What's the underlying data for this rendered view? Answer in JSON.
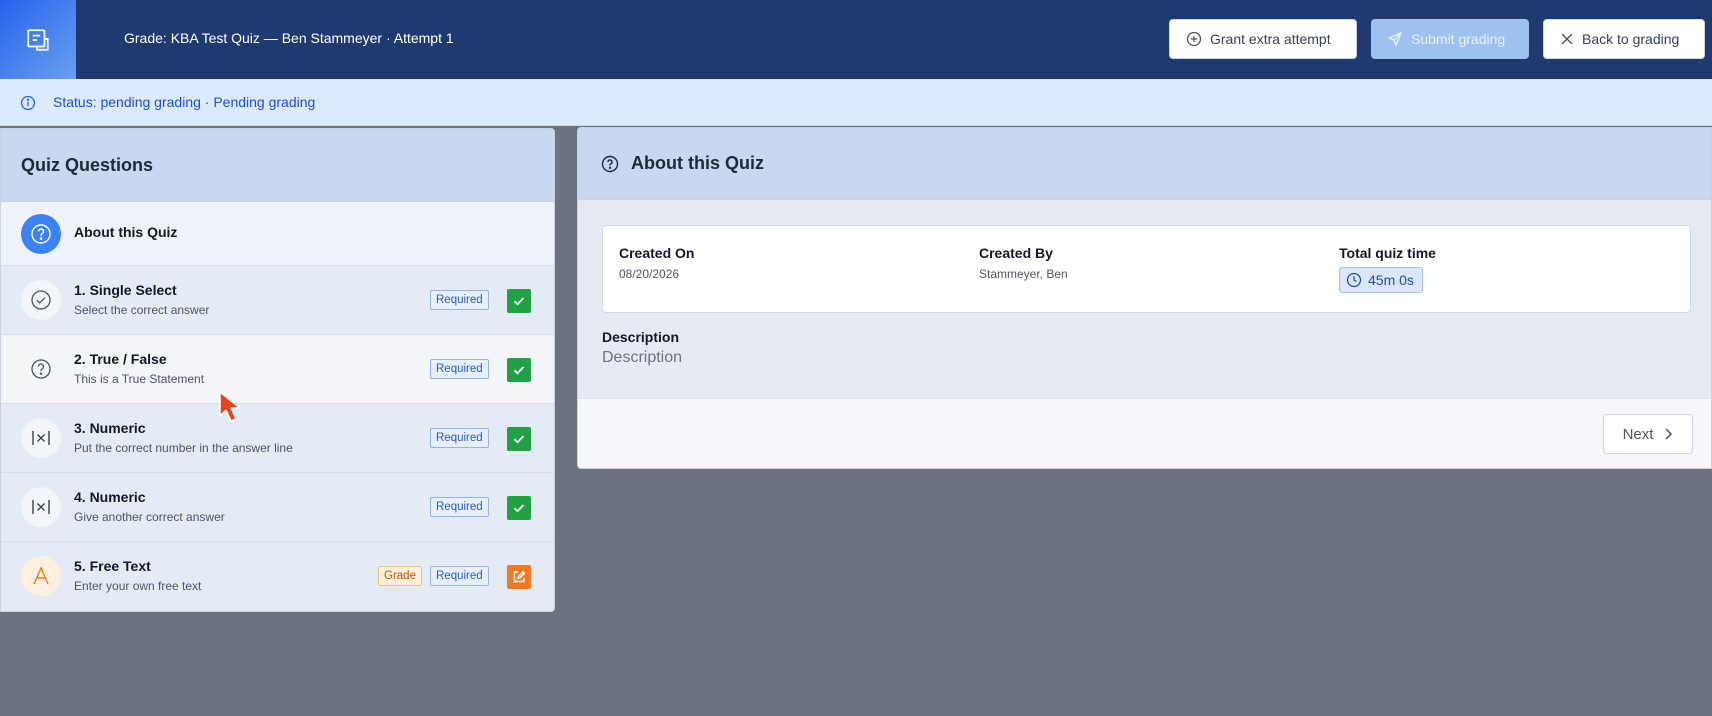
{
  "header": {
    "title": "Grade: KBA Test Quiz — Ben Stammeyer · Attempt 1",
    "logo_icon": "document-stack-icon",
    "grant_label": "Grant extra attempt",
    "submit_label": "Submit grading",
    "back_label": "Back to grading"
  },
  "status": {
    "text": "Status: pending grading · Pending grading"
  },
  "sidebar": {
    "title": "Quiz Questions",
    "items": [
      {
        "title": "About this Quiz",
        "subtitle": "",
        "icon": "question-circle-icon"
      },
      {
        "title": "1. Single Select",
        "subtitle": "Select the correct answer",
        "icon": "check-circle-icon",
        "required": "Required",
        "state": "done"
      },
      {
        "title": "2. True / False",
        "subtitle": "This is a True Statement",
        "icon": "question-circle-icon",
        "required": "Required",
        "state": "done"
      },
      {
        "title": "3. Numeric",
        "subtitle": "Put the correct number in the answer line",
        "icon": "numeric-icon",
        "required": "Required",
        "state": "done"
      },
      {
        "title": "4. Numeric",
        "subtitle": "Give another correct answer",
        "icon": "numeric-icon",
        "required": "Required",
        "state": "done"
      },
      {
        "title": "5. Free Text",
        "subtitle": "Enter your own free text",
        "icon": "text-a-icon",
        "grade": "Grade",
        "required": "Required",
        "state": "needs-grade"
      }
    ]
  },
  "main": {
    "title": "About this Quiz",
    "created_on_label": "Created On",
    "created_on": "08/20/2026",
    "created_by_label": "Created By",
    "created_by": "Stammeyer, Ben",
    "total_time_label": "Total quiz time",
    "total_time": "45m 0s",
    "description_label": "Description",
    "description": "Description",
    "next_label": "Next"
  },
  "colors": {
    "header_bg": "#1e3a6e",
    "status_bg": "#dbeafe",
    "done_green": "#22a046",
    "edit_orange": "#f07a24",
    "accent_blue": "#3b82f6"
  }
}
